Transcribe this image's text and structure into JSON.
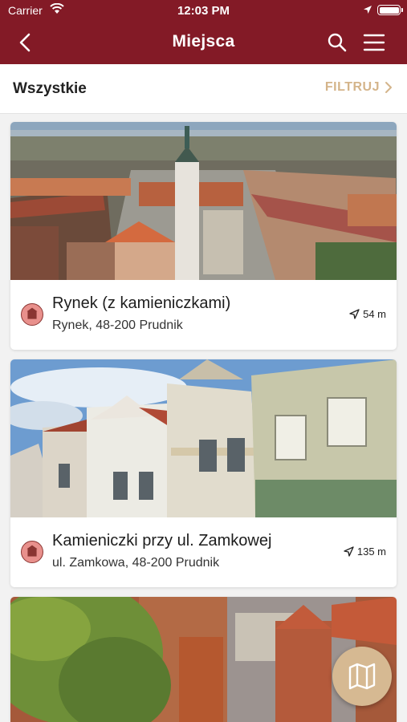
{
  "status_bar": {
    "carrier": "Carrier",
    "time": "12:03 PM"
  },
  "header": {
    "title": "Miejsca"
  },
  "filter_bar": {
    "label": "Wszystkie",
    "filter_button": "FILTRUJ"
  },
  "places": [
    {
      "name": "Rynek (z kamieniczkami)",
      "address": "Rynek, 48-200 Prudnik",
      "distance": "54 m",
      "category_icon": "building-icon"
    },
    {
      "name": "Kamieniczki przy ul. Zamkowej",
      "address": "ul. Zamkowa, 48-200 Prudnik",
      "distance": "135 m",
      "category_icon": "building-icon"
    }
  ],
  "colors": {
    "brand": "#831a26",
    "accent": "#d4b48a",
    "category": "#e8908c"
  }
}
